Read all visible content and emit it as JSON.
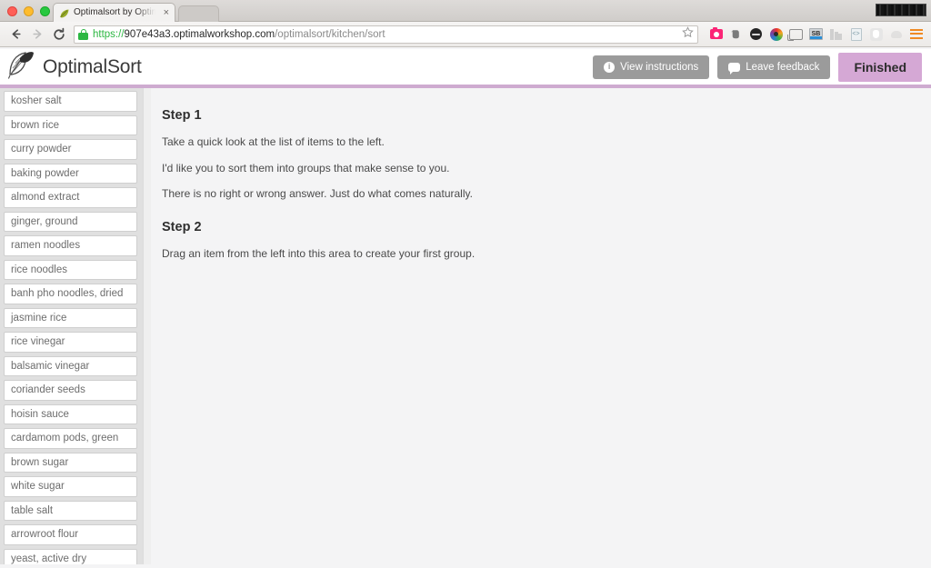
{
  "browser": {
    "tab": {
      "title": "Optimalsort by Optimal Wo",
      "close_label": "×",
      "favicon": "leaf-favicon"
    },
    "window_controls": {
      "close": "close",
      "minimize": "minimize",
      "maximize": "maximize"
    },
    "nav": {
      "back": "back-arrow",
      "forward": "forward-arrow",
      "reload": "reload-arrow"
    },
    "omnibox": {
      "secure_icon": "padlock-icon",
      "scheme": "https://",
      "host": "907e43a3.optimalworkshop.com",
      "path": "/optimalsort/kitchen/sort",
      "bookmark_icon": "star-icon"
    },
    "extensions": [
      {
        "name": "camera-extension-icon",
        "label": ""
      },
      {
        "name": "evernote-extension-icon",
        "label": ""
      },
      {
        "name": "dark-circle-extension-icon",
        "label": ""
      },
      {
        "name": "color-wheel-extension-icon",
        "label": ""
      },
      {
        "name": "cast-icon",
        "label": ""
      },
      {
        "name": "sb-extension-icon",
        "label": "SB"
      },
      {
        "name": "bar-chart-extension-icon",
        "label": ""
      },
      {
        "name": "code-document-extension-icon",
        "label": "<>"
      },
      {
        "name": "shield-extension-icon",
        "label": ""
      },
      {
        "name": "drive-extension-icon",
        "label": ""
      },
      {
        "name": "chrome-menu-icon",
        "label": ""
      }
    ]
  },
  "app": {
    "brand": "OptimalSort",
    "buttons": {
      "view_instructions": "View instructions",
      "leave_feedback": "Leave feedback",
      "finished": "Finished"
    },
    "accent_color": "#ceabd0",
    "finished_color": "#d5a8d5"
  },
  "sidebar": {
    "items": [
      "kosher salt",
      "brown rice",
      "curry powder",
      "baking powder",
      "almond extract",
      "ginger, ground",
      "ramen noodles",
      "rice noodles",
      "banh pho noodles, dried",
      "jasmine rice",
      "rice vinegar",
      "balsamic vinegar",
      "coriander seeds",
      "hoisin sauce",
      "cardamom pods, green",
      "brown sugar",
      "white sugar",
      "table salt",
      "arrowroot flour",
      "yeast, active dry"
    ]
  },
  "main": {
    "step1_title": "Step 1",
    "step1_lines": [
      "Take a quick look at the list of items to the left.",
      "I'd like you to sort them into groups that make sense to you.",
      "There is no right or wrong answer. Just do what comes naturally."
    ],
    "step2_title": "Step 2",
    "step2_lines": [
      "Drag an item from the left into this area to create your first group."
    ]
  }
}
